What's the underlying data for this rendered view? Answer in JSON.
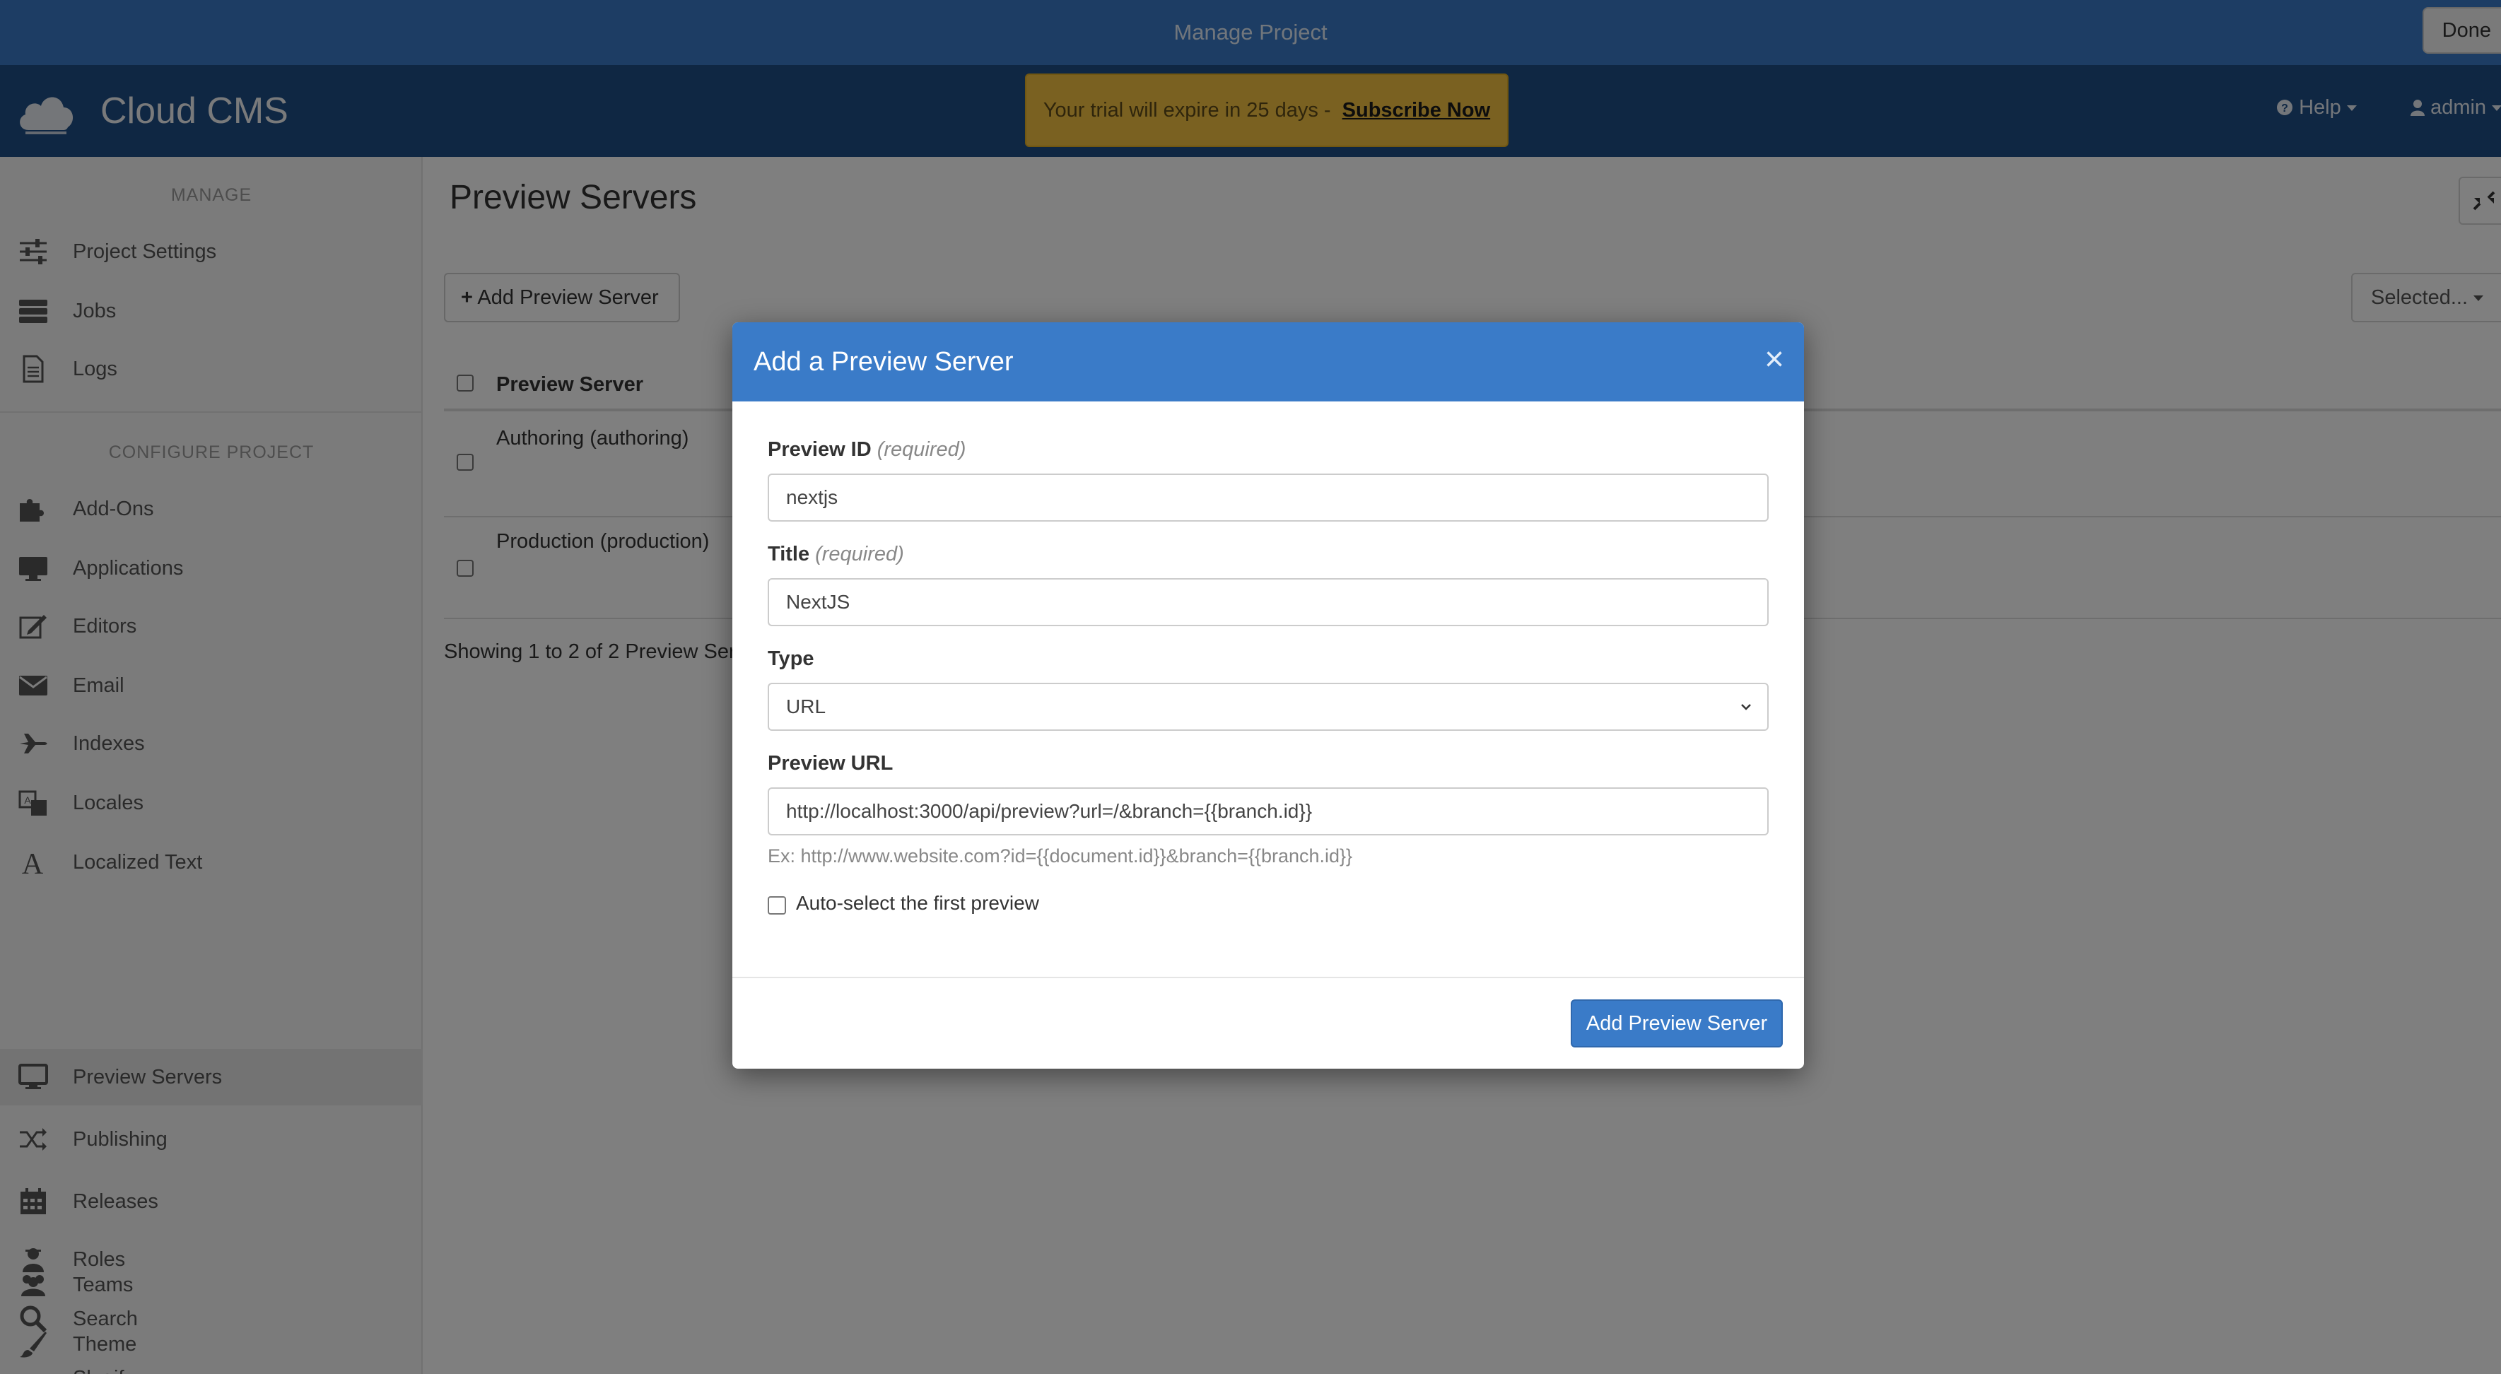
{
  "topbar": {
    "title": "Manage Project",
    "done_label": "Done"
  },
  "header": {
    "app_name": "Cloud CMS",
    "trial_text": "Your trial will expire in 25 days -",
    "subscribe_label": "Subscribe Now",
    "help_label": "Help",
    "user_label": "admin"
  },
  "sidebar": {
    "manage_label": "MANAGE",
    "configure_label": "CONFIGURE PROJECT",
    "manage_items": [
      {
        "label": "Project Settings",
        "icon": "sliders-icon"
      },
      {
        "label": "Jobs",
        "icon": "server-icon"
      },
      {
        "label": "Logs",
        "icon": "file-icon"
      }
    ],
    "config_items": [
      {
        "label": "Add-Ons",
        "icon": "puzzle-icon"
      },
      {
        "label": "Applications",
        "icon": "monitor-icon"
      },
      {
        "label": "Editors",
        "icon": "edit-icon"
      },
      {
        "label": "Email",
        "icon": "envelope-icon"
      },
      {
        "label": "Indexes",
        "icon": "plane-icon"
      },
      {
        "label": "Locales",
        "icon": "translate-icon"
      },
      {
        "label": "Localized Text",
        "icon": "font-icon"
      },
      {
        "label": "Preview Servers",
        "icon": "desktop-icon"
      },
      {
        "label": "Publishing",
        "icon": "shuffle-icon"
      },
      {
        "label": "Releases",
        "icon": "calendar-icon"
      },
      {
        "label": "Roles",
        "icon": "user-secret-icon"
      },
      {
        "label": "Search",
        "icon": "search-icon"
      },
      {
        "label": "Slugify",
        "icon": "az-icon"
      },
      {
        "label": "Teams",
        "icon": "users-icon"
      },
      {
        "label": "Theme",
        "icon": "brush-icon"
      }
    ],
    "active_item": "Preview Servers"
  },
  "main": {
    "page_title": "Preview Servers",
    "add_button_label": "Add Preview Server",
    "selected_label": "Selected...",
    "table": {
      "header": "Preview Server",
      "rows": [
        "Authoring (authoring)",
        "Production (production)"
      ]
    },
    "showing_text": "Showing 1 to 2 of 2 Preview Serv"
  },
  "modal": {
    "title": "Add a Preview Server",
    "close_symbol": "×",
    "required_text": "(required)",
    "preview_id_label": "Preview ID",
    "preview_id_value": "nextjs",
    "title_label": "Title",
    "title_value": "NextJS",
    "type_label": "Type",
    "type_value": "URL",
    "preview_url_label": "Preview URL",
    "preview_url_value": "http://localhost:3000/api/preview?url=/&branch={{branch.id}}",
    "preview_url_help": "Ex: http://www.website.com?id={{document.id}}&branch={{branch.id}}",
    "auto_select_label": "Auto-select the first preview",
    "auto_select_checked": false,
    "submit_label": "Add Preview Server"
  },
  "colors": {
    "topbar": "#3a7bc8",
    "header": "#1f4e86",
    "trial_banner": "#f5c342",
    "primary_button": "#3a7bc8"
  }
}
